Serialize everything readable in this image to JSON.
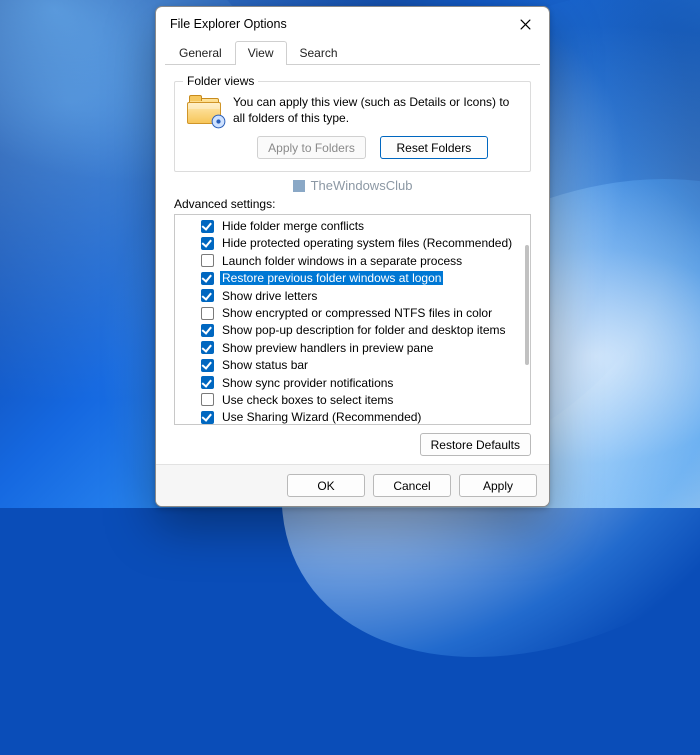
{
  "window": {
    "title": "File Explorer Options"
  },
  "tabs": [
    {
      "label": "General",
      "active": false
    },
    {
      "label": "View",
      "active": true
    },
    {
      "label": "Search",
      "active": false
    }
  ],
  "folder_views": {
    "legend": "Folder views",
    "description": "You can apply this view (such as Details or Icons) to all folders of this type.",
    "apply_label": "Apply to Folders",
    "reset_label": "Reset Folders"
  },
  "watermark": {
    "text": "TheWindowsClub"
  },
  "advanced": {
    "label": "Advanced settings:",
    "items": [
      {
        "checked": true,
        "selected": false,
        "label": "Hide folder merge conflicts"
      },
      {
        "checked": true,
        "selected": false,
        "label": "Hide protected operating system files (Recommended)"
      },
      {
        "checked": false,
        "selected": false,
        "label": "Launch folder windows in a separate process"
      },
      {
        "checked": true,
        "selected": true,
        "label": "Restore previous folder windows at logon"
      },
      {
        "checked": true,
        "selected": false,
        "label": "Show drive letters"
      },
      {
        "checked": false,
        "selected": false,
        "label": "Show encrypted or compressed NTFS files in color"
      },
      {
        "checked": true,
        "selected": false,
        "label": "Show pop-up description for folder and desktop items"
      },
      {
        "checked": true,
        "selected": false,
        "label": "Show preview handlers in preview pane"
      },
      {
        "checked": true,
        "selected": false,
        "label": "Show status bar"
      },
      {
        "checked": true,
        "selected": false,
        "label": "Show sync provider notifications"
      },
      {
        "checked": false,
        "selected": false,
        "label": "Use check boxes to select items"
      },
      {
        "checked": true,
        "selected": false,
        "label": "Use Sharing Wizard (Recommended)"
      }
    ],
    "restore_defaults_label": "Restore Defaults"
  },
  "footer": {
    "ok": "OK",
    "cancel": "Cancel",
    "apply": "Apply"
  }
}
